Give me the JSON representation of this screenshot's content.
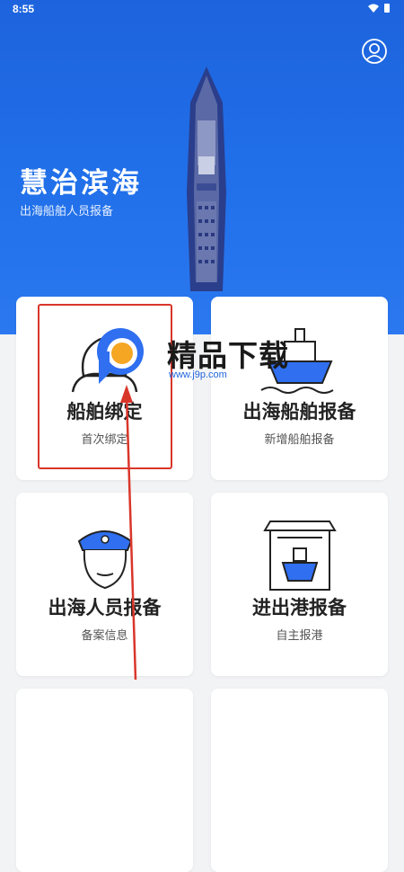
{
  "status_bar": {
    "time": "8:55"
  },
  "hero": {
    "title": "慧治滨海",
    "subtitle": "出海船舶人员报备",
    "profile_icon": "user-circle-icon"
  },
  "cards": [
    {
      "title": "船舶绑定",
      "subtitle": "首次绑定",
      "icon": "person-bind-icon"
    },
    {
      "title": "出海船舶报备",
      "subtitle": "新增船舶报备",
      "icon": "ship-on-waves-icon"
    },
    {
      "title": "出海人员报备",
      "subtitle": "备案信息",
      "icon": "sailor-icon"
    },
    {
      "title": "进出港报备",
      "subtitle": "自主报港",
      "icon": "harbor-gate-icon"
    }
  ],
  "watermark": {
    "text": "精品下载",
    "url": "www.j9p.com"
  },
  "colors": {
    "primary": "#2170ea",
    "highlight": "#d9362a",
    "accent": "#f5a623"
  }
}
